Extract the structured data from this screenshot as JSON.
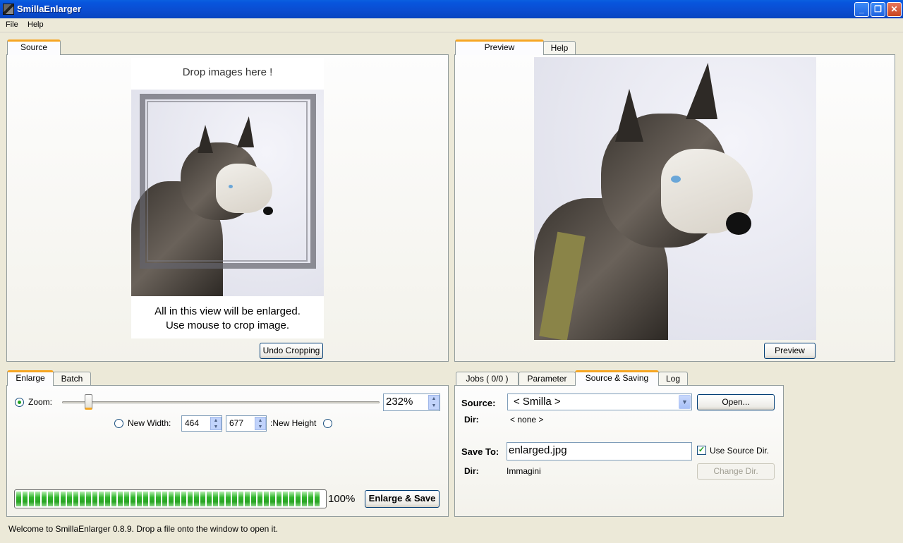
{
  "window": {
    "title": "SmillaEnlarger",
    "minimize": "_",
    "restore": "❐",
    "close": "✕"
  },
  "menu": {
    "file": "File",
    "help": "Help"
  },
  "source_panel": {
    "tab": "Source",
    "drop_hint": "Drop images here !",
    "caption_line1": "All in this view will be enlarged.",
    "caption_line2": "Use mouse to crop image.",
    "undo_button": "Undo Cropping"
  },
  "preview_panel": {
    "tabs": [
      "Preview",
      "Help"
    ],
    "preview_button": "Preview"
  },
  "enlarge_panel": {
    "tabs": [
      "Enlarge",
      "Batch"
    ],
    "zoom_label": "Zoom:",
    "zoom_value": "232%",
    "zoom_fraction": 0.07,
    "new_width_label": "New Width:",
    "width_value": "464",
    "height_value": "677",
    "new_height_label": ":New Height",
    "progress_percent": 100,
    "progress_text": "100%",
    "enlarge_button": "Enlarge & Save"
  },
  "settings_panel": {
    "tabs": [
      "Jobs ( 0/0 )",
      "Parameter",
      "Source & Saving",
      "Log"
    ],
    "source_label": "Source:",
    "source_value": "< Smilla >",
    "open_button": "Open...",
    "dir_label": "Dir:",
    "source_dir_value": "< none >",
    "save_to_label": "Save To:",
    "save_to_value": "enlarged.jpg",
    "use_source_dir_label": "Use Source Dir.",
    "use_source_dir_checked": true,
    "save_dir_label": "Dir:",
    "save_dir_value": "Immagini",
    "change_dir_button": "Change Dir."
  },
  "status": {
    "text": "Welcome to SmillaEnlarger 0.8.9.  Drop a file onto the window to open it."
  }
}
